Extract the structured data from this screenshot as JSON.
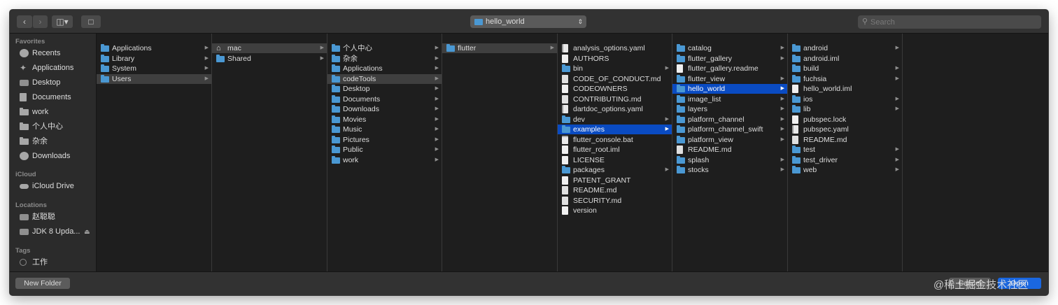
{
  "toolbar": {
    "path_popup": "hello_world",
    "search_placeholder": "Search"
  },
  "sidebar": {
    "sections": [
      {
        "title": "Favorites",
        "items": [
          {
            "label": "Recents",
            "icon": "clock-icon"
          },
          {
            "label": "Applications",
            "icon": "applications-icon"
          },
          {
            "label": "Desktop",
            "icon": "desktop-icon"
          },
          {
            "label": "Documents",
            "icon": "documents-icon"
          },
          {
            "label": "work",
            "icon": "folder-icon"
          },
          {
            "label": "个人中心",
            "icon": "folder-icon"
          },
          {
            "label": "杂余",
            "icon": "folder-icon"
          },
          {
            "label": "Downloads",
            "icon": "downloads-icon"
          }
        ]
      },
      {
        "title": "iCloud",
        "items": [
          {
            "label": "iCloud Drive",
            "icon": "cloud-icon"
          }
        ]
      },
      {
        "title": "Locations",
        "items": [
          {
            "label": "赵聪聪",
            "icon": "computer-icon"
          },
          {
            "label": "JDK 8 Upda...",
            "icon": "disk-icon",
            "eject": true
          }
        ]
      },
      {
        "title": "Tags",
        "items": [
          {
            "label": "工作",
            "icon": "tag-icon"
          }
        ]
      }
    ]
  },
  "columns": [
    {
      "items": [
        {
          "name": "Applications",
          "type": "folder",
          "arrow": true
        },
        {
          "name": "Library",
          "type": "folder",
          "arrow": true
        },
        {
          "name": "System",
          "type": "folder",
          "arrow": true
        },
        {
          "name": "Users",
          "type": "folder",
          "arrow": true,
          "selected": "grey"
        }
      ]
    },
    {
      "items": [
        {
          "name": "mac",
          "type": "home",
          "arrow": true,
          "selected": "grey"
        },
        {
          "name": "Shared",
          "type": "folder",
          "arrow": true
        }
      ]
    },
    {
      "items": [
        {
          "name": "个人中心",
          "type": "folder",
          "arrow": true
        },
        {
          "name": "杂余",
          "type": "folder",
          "arrow": true
        },
        {
          "name": "Applications",
          "type": "folder",
          "arrow": true
        },
        {
          "name": "codeTools",
          "type": "folder",
          "arrow": true,
          "selected": "grey"
        },
        {
          "name": "Desktop",
          "type": "folder",
          "arrow": true
        },
        {
          "name": "Documents",
          "type": "folder",
          "arrow": true
        },
        {
          "name": "Downloads",
          "type": "folder",
          "arrow": true
        },
        {
          "name": "Movies",
          "type": "folder",
          "arrow": true
        },
        {
          "name": "Music",
          "type": "folder",
          "arrow": true
        },
        {
          "name": "Pictures",
          "type": "folder",
          "arrow": true
        },
        {
          "name": "Public",
          "type": "folder",
          "arrow": true
        },
        {
          "name": "work",
          "type": "folder",
          "arrow": true
        }
      ]
    },
    {
      "items": [
        {
          "name": "flutter",
          "type": "folder",
          "arrow": true,
          "selected": "grey"
        }
      ]
    },
    {
      "items": [
        {
          "name": "analysis_options.yaml",
          "type": "dart"
        },
        {
          "name": "AUTHORS",
          "type": "file"
        },
        {
          "name": "bin",
          "type": "folder",
          "arrow": true
        },
        {
          "name": "CODE_OF_CONDUCT.md",
          "type": "md"
        },
        {
          "name": "CODEOWNERS",
          "type": "file"
        },
        {
          "name": "CONTRIBUTING.md",
          "type": "md"
        },
        {
          "name": "dartdoc_options.yaml",
          "type": "dart"
        },
        {
          "name": "dev",
          "type": "folder",
          "arrow": true
        },
        {
          "name": "examples",
          "type": "folder",
          "arrow": true,
          "selected": "blue"
        },
        {
          "name": "flutter_console.bat",
          "type": "xml"
        },
        {
          "name": "flutter_root.iml",
          "type": "file"
        },
        {
          "name": "LICENSE",
          "type": "file"
        },
        {
          "name": "packages",
          "type": "folder",
          "arrow": true
        },
        {
          "name": "PATENT_GRANT",
          "type": "file"
        },
        {
          "name": "README.md",
          "type": "md"
        },
        {
          "name": "SECURITY.md",
          "type": "md"
        },
        {
          "name": "version",
          "type": "file"
        }
      ]
    },
    {
      "items": [
        {
          "name": "catalog",
          "type": "folder",
          "arrow": true
        },
        {
          "name": "flutter_gallery",
          "type": "folder",
          "arrow": true
        },
        {
          "name": "flutter_gallery.readme",
          "type": "file"
        },
        {
          "name": "flutter_view",
          "type": "folder",
          "arrow": true
        },
        {
          "name": "hello_world",
          "type": "folder",
          "arrow": true,
          "selected": "blue"
        },
        {
          "name": "image_list",
          "type": "folder",
          "arrow": true
        },
        {
          "name": "layers",
          "type": "folder",
          "arrow": true
        },
        {
          "name": "platform_channel",
          "type": "folder",
          "arrow": true
        },
        {
          "name": "platform_channel_swift",
          "type": "folder",
          "arrow": true
        },
        {
          "name": "platform_view",
          "type": "folder",
          "arrow": true
        },
        {
          "name": "README.md",
          "type": "md"
        },
        {
          "name": "splash",
          "type": "folder",
          "arrow": true
        },
        {
          "name": "stocks",
          "type": "folder",
          "arrow": true
        }
      ]
    },
    {
      "items": [
        {
          "name": "android",
          "type": "folder",
          "arrow": true
        },
        {
          "name": "android.iml",
          "type": "folder"
        },
        {
          "name": "build",
          "type": "folder",
          "arrow": true
        },
        {
          "name": "fuchsia",
          "type": "folder",
          "arrow": true
        },
        {
          "name": "hello_world.iml",
          "type": "file"
        },
        {
          "name": "ios",
          "type": "folder",
          "arrow": true
        },
        {
          "name": "lib",
          "type": "folder",
          "arrow": true
        },
        {
          "name": "pubspec.lock",
          "type": "file"
        },
        {
          "name": "pubspec.yaml",
          "type": "dart"
        },
        {
          "name": "README.md",
          "type": "md"
        },
        {
          "name": "test",
          "type": "folder",
          "arrow": true
        },
        {
          "name": "test_driver",
          "type": "folder",
          "arrow": true
        },
        {
          "name": "web",
          "type": "folder",
          "arrow": true
        }
      ]
    },
    {
      "items": []
    }
  ],
  "bottombar": {
    "new_folder_label": "New Folder",
    "cancel_label": "Cancel",
    "open_label": "Open"
  },
  "watermark": "@稀土掘金技术社区",
  "colors": {
    "selection_blue": "#0a4bc2",
    "folder_blue": "#4a98d3",
    "open_button": "#1a67e0"
  }
}
